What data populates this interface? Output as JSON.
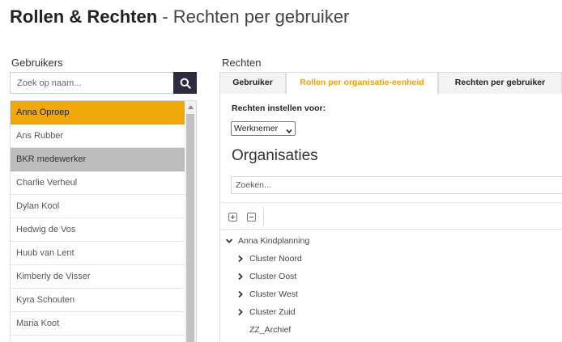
{
  "header": {
    "title_main": "Rollen & Rechten",
    "title_separator": " - ",
    "title_sub": "Rechten per gebruiker"
  },
  "users": {
    "heading": "Gebruikers",
    "search_placeholder": "Zoek op naam...",
    "items": [
      {
        "label": "Anna Oproep"
      },
      {
        "label": "Ans Rubber"
      },
      {
        "label": "BKR medewerker"
      },
      {
        "label": "Charlie Verheul"
      },
      {
        "label": "Dylan Kool"
      },
      {
        "label": "Hedwig de Vos"
      },
      {
        "label": "Huub van Lent"
      },
      {
        "label": "Kimberly de Visser"
      },
      {
        "label": "Kyra Schouten"
      },
      {
        "label": "Maria Koot"
      }
    ]
  },
  "rights": {
    "heading": "Rechten",
    "tabs": [
      {
        "label": "Gebruiker"
      },
      {
        "label": "Rollen per organisatie-eenheid"
      },
      {
        "label": "Rechten per gebruiker"
      }
    ],
    "set_for_label": "Rechten instellen voor:",
    "role_select_value": "Werknemer",
    "org_heading": "Organisaties",
    "org_search_placeholder": "Zoeken...",
    "tree": {
      "root": "Anna Kindplanning",
      "children": [
        {
          "label": "Cluster Noord"
        },
        {
          "label": "Cluster Oost"
        },
        {
          "label": "Cluster West"
        },
        {
          "label": "Cluster Zuid"
        },
        {
          "label": "ZZ_Archief"
        }
      ]
    }
  },
  "colors": {
    "accent": "#f0a70a",
    "tab_active_text": "#e8a013",
    "search_button": "#2d2c3f",
    "highlight_row": "#bdbdbd"
  },
  "icons": {
    "search": "search-icon",
    "chevron_down": "chevron-down-icon",
    "chevron_right": "chevron-right-icon",
    "expand_all": "expand-all-icon",
    "collapse_all": "collapse-all-icon",
    "scroll_up": "scroll-up-arrow-icon"
  }
}
